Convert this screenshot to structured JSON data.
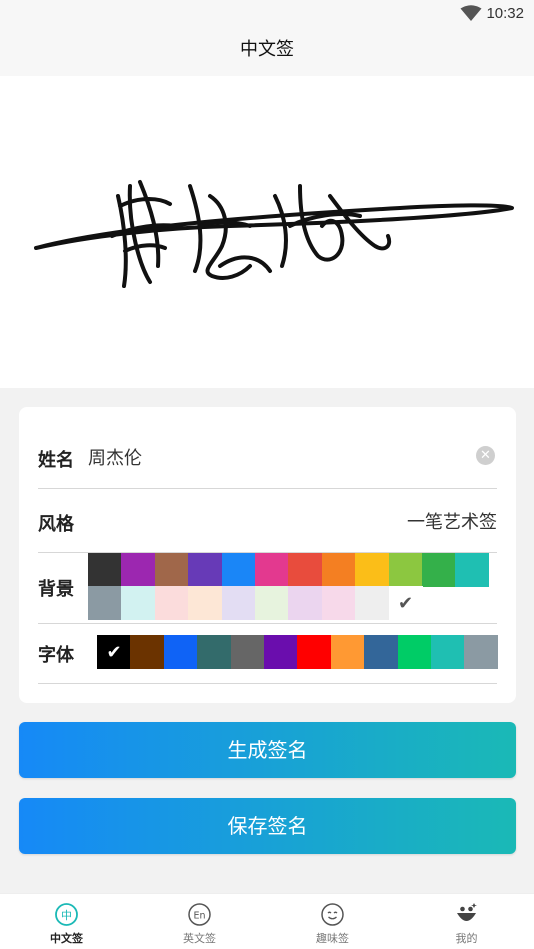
{
  "status_bar": {
    "time": "10:32"
  },
  "header": {
    "title": "中文签"
  },
  "form": {
    "name_label": "姓名",
    "name_value": "周杰伦",
    "style_label": "风格",
    "style_value": "一笔艺术签",
    "background_label": "背景",
    "font_label": "字体",
    "background_colors_row1": [
      "#333333",
      "#9c27b0",
      "#a0674a",
      "#673ab7",
      "#1a86f7",
      "#e3398f",
      "#e84c3d",
      "#f47f22",
      "#fbbe18",
      "#8cc740",
      "#34b04a",
      "#1fbfb2"
    ],
    "background_colors_row2": [
      "#8b9aa3",
      "#d2f2f1",
      "#fbdcdc",
      "#fde7d6",
      "#e3ddf3",
      "#e7f3de",
      "#ebd5ef",
      "#f7d9ea",
      "#eeeeee",
      "#ffffff"
    ],
    "background_selected": "#ffffff",
    "font_colors": [
      "#000000",
      "#6b3300",
      "#0f63f6",
      "#336b6b",
      "#666666",
      "#6a0dad",
      "#ff0000",
      "#ff9933",
      "#336699",
      "#00cc66",
      "#1fbfb2",
      "#8b9aa3"
    ],
    "font_selected": "#000000"
  },
  "buttons": {
    "generate": "生成签名",
    "save": "保存签名"
  },
  "nav": {
    "items": [
      {
        "label": "中文签",
        "icon": "chinese-signature-icon",
        "active": true
      },
      {
        "label": "英文签",
        "icon": "english-signature-icon",
        "active": false
      },
      {
        "label": "趣味签",
        "icon": "fun-signature-icon",
        "active": false
      },
      {
        "label": "我的",
        "icon": "profile-icon",
        "active": false
      }
    ]
  }
}
